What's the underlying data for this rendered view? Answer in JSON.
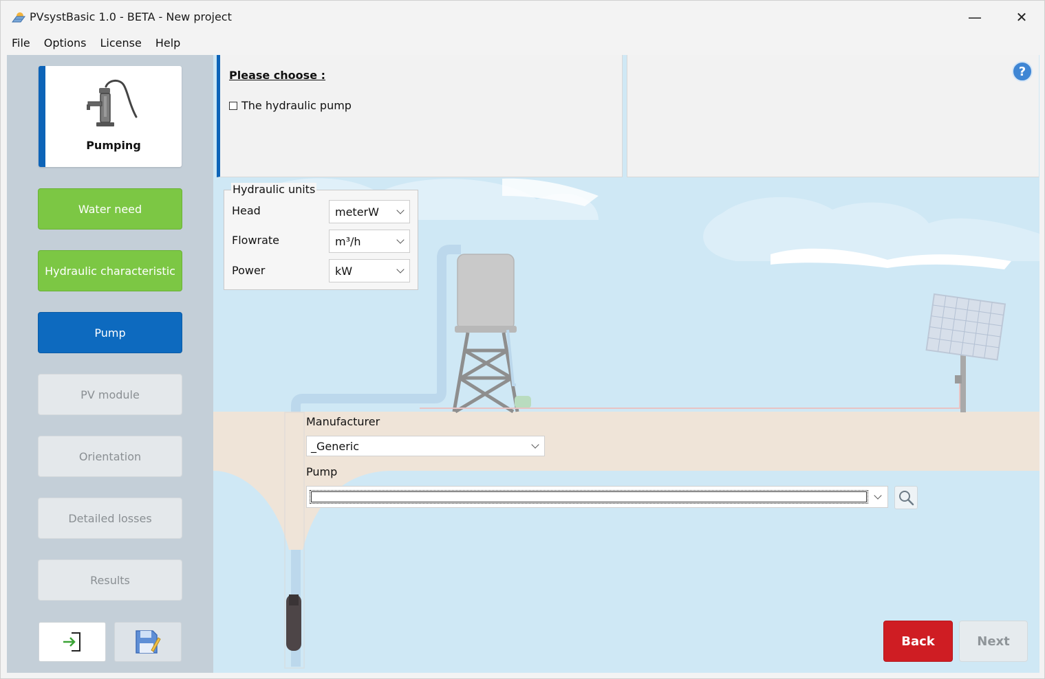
{
  "window": {
    "title": "PVsystBasic 1.0 - BETA - New project",
    "minimize_glyph": "—",
    "close_glyph": "✕"
  },
  "menu": {
    "items": [
      "File",
      "Options",
      "License",
      "Help"
    ]
  },
  "sidebar": {
    "active_card_label": "Pumping",
    "active_card_icon": "hand-pump-icon",
    "steps": [
      {
        "label": "Water need",
        "state": "done"
      },
      {
        "label": "Hydraulic characteristic",
        "state": "done"
      },
      {
        "label": "Pump",
        "state": "current"
      },
      {
        "label": "PV module",
        "state": "disabled"
      },
      {
        "label": "Orientation",
        "state": "disabled"
      },
      {
        "label": "Detailed losses",
        "state": "disabled"
      },
      {
        "label": "Results",
        "state": "disabled"
      }
    ],
    "bottom_icons": [
      "login-arrow-icon",
      "save-disk-icon"
    ]
  },
  "choose_panel": {
    "title": "Please choose :",
    "items": [
      "The hydraulic pump"
    ]
  },
  "help_panel": {
    "icon_glyph": "?"
  },
  "hydraulic_units": {
    "legend": "Hydraulic units",
    "rows": [
      {
        "label": "Head",
        "value": "meterW"
      },
      {
        "label": "Flowrate",
        "value": "m³/h"
      },
      {
        "label": "Power",
        "value": "kW"
      }
    ]
  },
  "selection": {
    "manufacturer_label": "Manufacturer",
    "manufacturer_value": "_Generic",
    "pump_label": "Pump",
    "pump_value": ""
  },
  "actions": {
    "back_label": "Back",
    "next_label": "Next"
  },
  "colors": {
    "accent_blue": "#0d64b8",
    "step_done_green": "#7cc744",
    "back_red": "#cf1d23",
    "sidebar_bg": "#c4cfd8",
    "sky": "#cfe8f5",
    "ground": "#efe4d8"
  }
}
